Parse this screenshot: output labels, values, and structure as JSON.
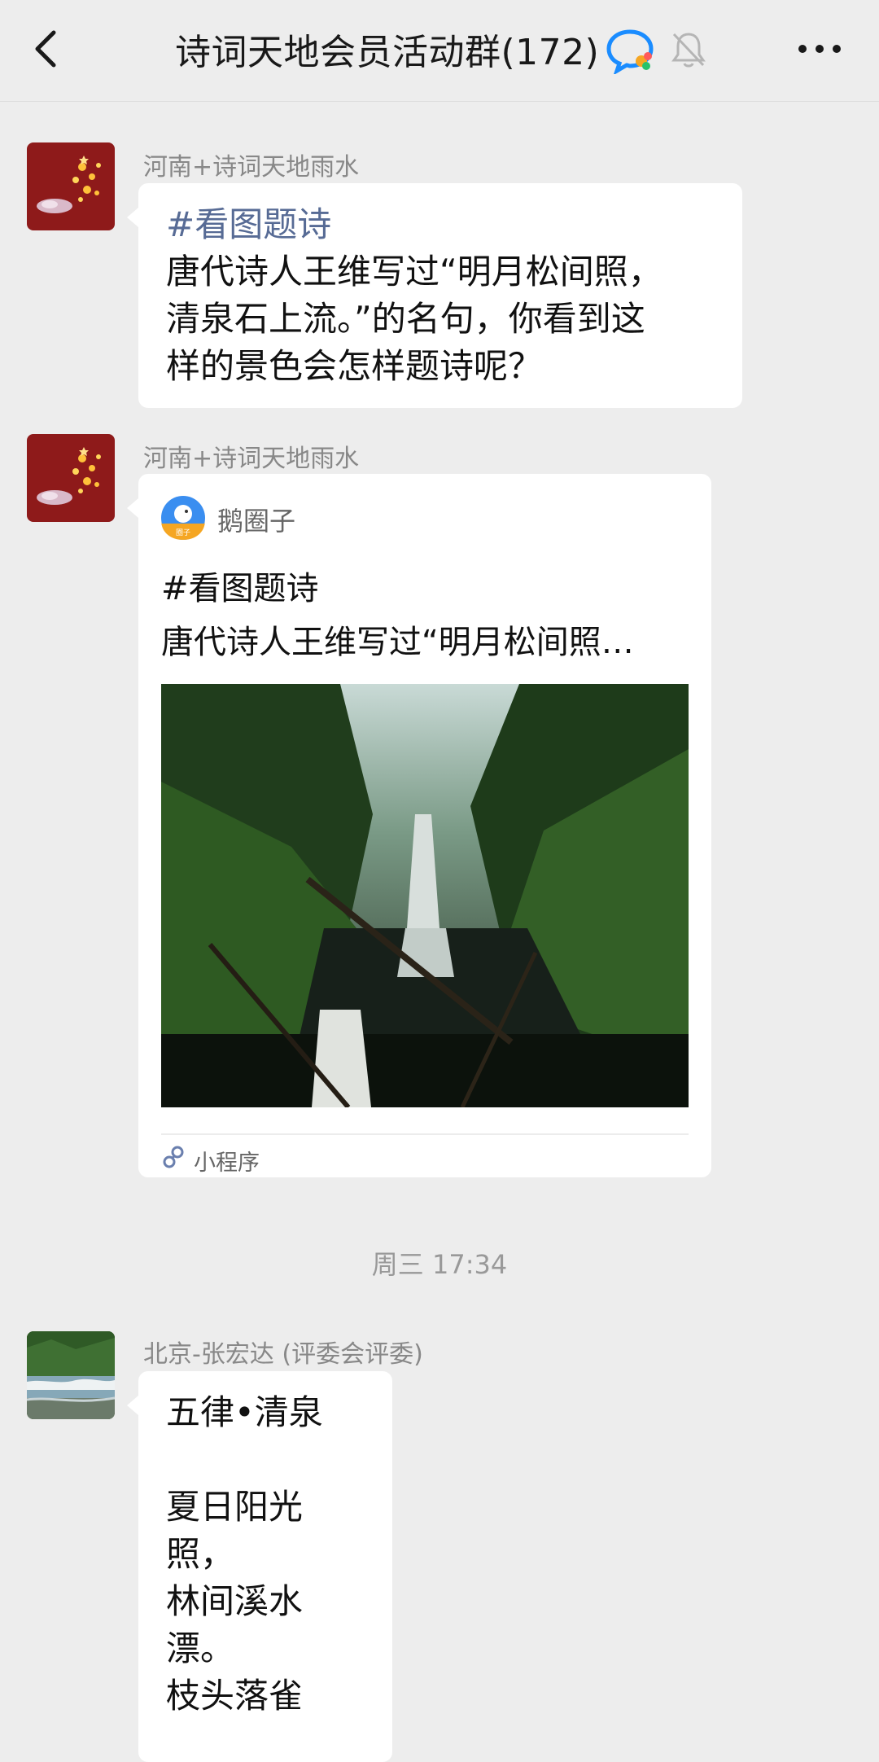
{
  "header": {
    "title": "诗词天地会员活动群(172)",
    "icons": [
      "back-arrow-icon",
      "chat-bubble-icon",
      "bell-muted-icon",
      "more-icon"
    ]
  },
  "messages": [
    {
      "sender": "河南+诗词天地雨水",
      "hashtag": "#看图题诗",
      "text": [
        "唐代诗人王维写过“明月松间照，",
        "清泉石上流。”的名句，你看到这",
        "样的景色会怎样题诗呢？"
      ]
    },
    {
      "sender": "河南+诗词天地雨水",
      "card": {
        "app_name": "鹅圈子",
        "logo_label": "圈子",
        "title": "#看图题诗",
        "desc": "唐代诗人王维写过“明月松间照…",
        "footer": "小程序"
      }
    }
  ],
  "timestamp": "周三 17:34",
  "message3": {
    "sender": "北京-张宏达 (评委会评委)",
    "lines": [
      "五律•清泉",
      "",
      "夏日阳光",
      "照，",
      "林间溪水",
      "漂。",
      "枝头落雀"
    ]
  },
  "colors": {
    "background": "#ededed",
    "bubble": "#ffffff",
    "hashtag": "#576b95",
    "avatar_red": "#8e1a1a"
  }
}
